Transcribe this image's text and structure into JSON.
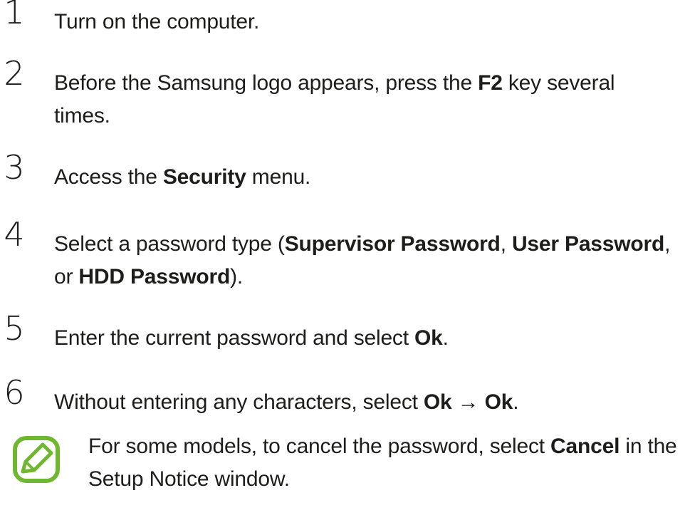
{
  "steps": [
    {
      "num": "1",
      "parts": [
        {
          "t": "Turn on the computer."
        }
      ]
    },
    {
      "num": "2",
      "parts": [
        {
          "t": "Before the Samsung logo appears, press the "
        },
        {
          "t": "F2",
          "b": true
        },
        {
          "t": " key several times."
        }
      ]
    },
    {
      "num": "3",
      "parts": [
        {
          "t": "Access the "
        },
        {
          "t": "Security",
          "b": true
        },
        {
          "t": " menu."
        }
      ]
    },
    {
      "num": "4",
      "parts": [
        {
          "t": "Select a password type ("
        },
        {
          "t": "Supervisor Password",
          "b": true
        },
        {
          "t": ", "
        },
        {
          "t": "User Password",
          "b": true
        },
        {
          "t": ", or "
        },
        {
          "t": "HDD Password",
          "b": true
        },
        {
          "t": ")."
        }
      ]
    },
    {
      "num": "5",
      "parts": [
        {
          "t": "Enter the current password and select "
        },
        {
          "t": "Ok",
          "b": true
        },
        {
          "t": "."
        }
      ]
    },
    {
      "num": "6",
      "parts": [
        {
          "t": "Without entering any characters, select "
        },
        {
          "t": "Ok",
          "b": true
        },
        {
          "t": " → "
        },
        {
          "t": "Ok",
          "b": true
        },
        {
          "t": "."
        }
      ]
    }
  ],
  "note": {
    "icon": "note-pencil-icon",
    "color": "#6fb72e",
    "parts": [
      {
        "t": "For some models, to cancel the password, select "
      },
      {
        "t": "Cancel",
        "b": true
      },
      {
        "t": " in the Setup Notice window."
      }
    ]
  }
}
